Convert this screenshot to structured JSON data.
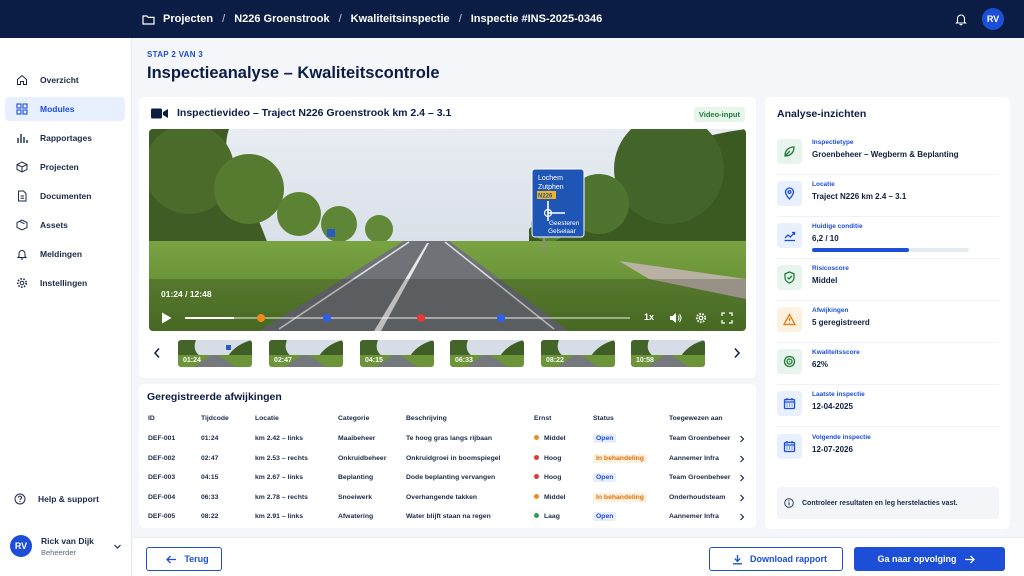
{
  "breadcrumbs": [
    "Projecten",
    "N226 Groenstrook",
    "Kwaliteitsinspectie",
    "Inspectie #INS-2025-0346"
  ],
  "user": {
    "initials": "RV",
    "name": "Rick van Dijk",
    "role": "Beheerder"
  },
  "sidebar": {
    "items": [
      {
        "label": "Overzicht",
        "icon": "home-icon",
        "active": false
      },
      {
        "label": "Modules",
        "icon": "grid-icon",
        "active": true
      },
      {
        "label": "Rapportages",
        "icon": "bar-chart-icon",
        "active": false
      },
      {
        "label": "Projecten",
        "icon": "cube-icon",
        "active": false
      },
      {
        "label": "Documenten",
        "icon": "document-icon",
        "active": false
      },
      {
        "label": "Assets",
        "icon": "box-icon",
        "active": false
      },
      {
        "label": "Meldingen",
        "icon": "bell-icon",
        "active": false
      },
      {
        "label": "Instellingen",
        "icon": "gear-icon",
        "active": false
      }
    ],
    "help": "Help & support"
  },
  "page": {
    "step": "STAP 2 VAN 3",
    "title": "Inspectieanalyse – Kwaliteitscontrole"
  },
  "video": {
    "title": "Inspectievideo – Traject N226 Groenstrook km 2.4 – 3.1",
    "badge": "Video-input",
    "time": "01:24 / 12:48",
    "progress_fraction": 0.11,
    "speed": "1x",
    "sign": {
      "line1": "Lochem",
      "line2": "Zutphen",
      "road": "N226",
      "line3": "Geesteren",
      "line4": "Gelselaar"
    },
    "markers": [
      {
        "fraction": 0.17,
        "color": "#f08a1c"
      },
      {
        "fraction": 0.32,
        "color": "#2f5fe8"
      },
      {
        "fraction": 0.53,
        "color": "#e53935"
      },
      {
        "fraction": 0.71,
        "color": "#2f5fe8"
      }
    ],
    "thumbnails": [
      "01:24",
      "02:47",
      "04:15",
      "06:33",
      "08:22",
      "10:58"
    ]
  },
  "table": {
    "title": "Geregistreerde afwijkingen",
    "columns": [
      "ID",
      "Tijdcode",
      "Locatie",
      "Categorie",
      "Beschrijving",
      "Ernst",
      "Status",
      "Toegewezen aan"
    ],
    "rows": [
      {
        "id": "DEF-001",
        "time": "01:24",
        "location": "km 2.42 – links",
        "category": "Maaibeheer",
        "description": "Te hoog gras langs rijbaan",
        "severity": "Middel",
        "severity_color": "#f08a1c",
        "status": "Open",
        "status_type": "open",
        "assignee": "Team Groenbeheer"
      },
      {
        "id": "DEF-002",
        "time": "02:47",
        "location": "km 2.53 – rechts",
        "category": "Onkruidbeheer",
        "description": "Onkruidgroei in boomspiegel",
        "severity": "Hoog",
        "severity_color": "#e53935",
        "status": "In behandeling",
        "status_type": "busy",
        "assignee": "Aannemer Infra"
      },
      {
        "id": "DEF-003",
        "time": "04:15",
        "location": "km 2.67 – links",
        "category": "Beplanting",
        "description": "Dode beplanting vervangen",
        "severity": "Hoog",
        "severity_color": "#e53935",
        "status": "Open",
        "status_type": "open",
        "assignee": "Team Groenbeheer"
      },
      {
        "id": "DEF-004",
        "time": "06:33",
        "location": "km 2.78 – rechts",
        "category": "Snoeiwerk",
        "description": "Overhangende takken",
        "severity": "Middel",
        "severity_color": "#f08a1c",
        "status": "In behandeling",
        "status_type": "busy",
        "assignee": "Onderhoudsteam"
      },
      {
        "id": "DEF-005",
        "time": "08:22",
        "location": "km 2.91 – links",
        "category": "Afwatering",
        "description": "Water blijft staan na regen",
        "severity": "Laag",
        "severity_color": "#2e9e4f",
        "status": "Open",
        "status_type": "open",
        "assignee": "Aannemer Infra"
      }
    ]
  },
  "insights": {
    "title": "Analyse-inzichten",
    "items": [
      {
        "label": "Inspectietype",
        "value": "Groenbeheer – Wegberm & Beplanting",
        "icon": "leaf-icon",
        "bg": "#e8f5ec",
        "fg": "#1e7b3a"
      },
      {
        "label": "Locatie",
        "value": "Traject N226 km 2.4 – 3.1",
        "icon": "location-pin-icon",
        "bg": "#e8efff",
        "fg": "#1d4ed8"
      },
      {
        "label": "Huidige conditie",
        "value": "6,2 / 10",
        "icon": "trend-chart-icon",
        "bg": "#e8efff",
        "fg": "#1d4ed8",
        "progress": 0.62
      },
      {
        "label": "Risicoscore",
        "value": "Middel",
        "icon": "shield-check-icon",
        "bg": "#e8f5ec",
        "fg": "#1e7b3a"
      },
      {
        "label": "Afwijkingen",
        "value": "5 geregistreerd",
        "icon": "warning-icon",
        "bg": "#fff1e0",
        "fg": "#e07b12"
      },
      {
        "label": "Kwaliteitsscore",
        "value": "62%",
        "icon": "target-icon",
        "bg": "#e8f5ec",
        "fg": "#1e7b3a"
      },
      {
        "label": "Laatste inspectie",
        "value": "12-04-2025",
        "icon": "calendar-icon",
        "bg": "#e8efff",
        "fg": "#1d4ed8"
      },
      {
        "label": "Volgende inspectie",
        "value": "12-07-2026",
        "icon": "calendar-icon",
        "bg": "#e8efff",
        "fg": "#1d4ed8"
      }
    ],
    "note": "Controleer resultaten en leg herstelacties vast."
  },
  "footer": {
    "back": "Terug",
    "download": "Download rapport",
    "next": "Ga naar opvolging"
  }
}
